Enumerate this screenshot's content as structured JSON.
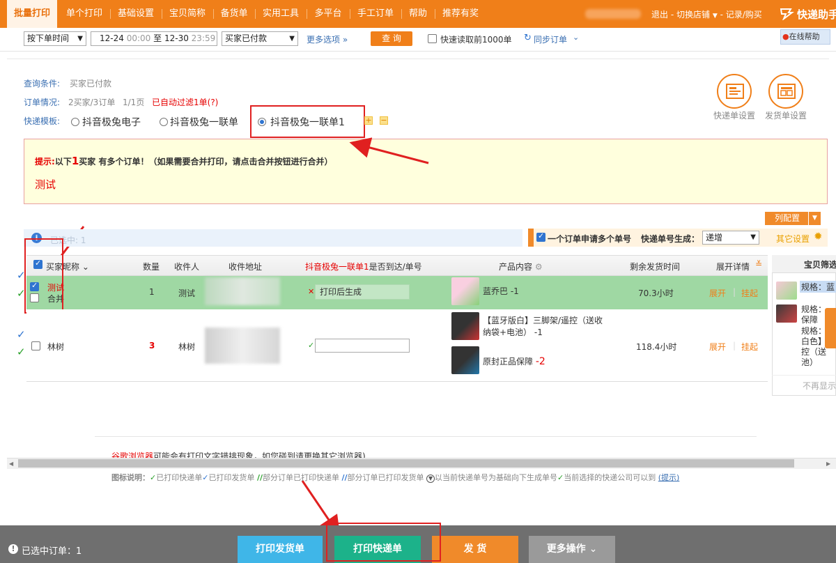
{
  "nav": {
    "items": [
      "批量打印",
      "单个打印",
      "基础设置",
      "宝贝简称",
      "备货单",
      "实用工具",
      "多平台",
      "手工订单",
      "帮助",
      "推荐有奖"
    ],
    "right_links": [
      "退出",
      "切换店铺",
      "记录/购买"
    ],
    "brand": "快递助手"
  },
  "query_bar": {
    "time_type": "按下单时间",
    "date_from": "12-24",
    "time_from": "00:00",
    "date_sep": "至",
    "date_to": "12-30",
    "time_to": "23:59",
    "status": "买家已付款",
    "more_options": "更多选项 »",
    "query_button": "查 询",
    "quick_read_label": "快速读取前1000单",
    "sync_orders": "同步订单",
    "online_help": "在线帮助"
  },
  "info": {
    "query_condition_label": "查询条件:",
    "query_condition_value": "买家已付款",
    "order_status_label": "订单情况:",
    "order_counts": "2买家/3订单",
    "pages": "1/1页",
    "auto_filter": "已自动过滤1单(?)",
    "template_label": "快递模板:",
    "templates": [
      "抖音极兔电子",
      "抖音极兔一联单",
      "抖音极兔一联单1"
    ],
    "selected_template_index": 2,
    "express_settings": "快递单设置",
    "invoice_settings": "发货单设置"
  },
  "notice": {
    "prefix": "提示:",
    "text_before": "以下",
    "count": "1",
    "text_after": "买家 有多个订单！（如果需要合并打印，请点击合并按钮进行合并）",
    "test_text": "测试"
  },
  "column_config_button": "列配置",
  "selected_bar": {
    "label": "已选中:",
    "count": "1"
  },
  "orange_bar": {
    "multi_number_label": "一个订单申请多个单号",
    "number_gen_label": "快递单号生成：",
    "number_gen_value": "递增",
    "other_settings": "其它设置"
  },
  "table": {
    "headers": {
      "buyer": "买家昵称",
      "qty": "数量",
      "receiver": "收件人",
      "address": "收件地址",
      "template_col_red": "抖音极兔一联单1",
      "template_col_black": "是否到达/单号",
      "product": "产品内容",
      "remaining": "剩余发货时间",
      "expand": "展开详情"
    },
    "rows": [
      {
        "buyer": "测试",
        "merge": "合并",
        "qty": "1",
        "receiver": "测试",
        "tracking_text": "打印后生成",
        "products": [
          {
            "name": "蓝乔巴",
            "qty": "-1"
          }
        ],
        "remaining": "70.3小时",
        "expand": "展开",
        "hold": "挂起"
      },
      {
        "buyer": "林树",
        "qty": "3",
        "receiver": "林树",
        "tracking_text": "",
        "products": [
          {
            "name": "【蓝牙版白】三脚架/遥控（送收纳袋+电池）",
            "qty": "-1"
          },
          {
            "name": "原封正品保障",
            "qty": "-2"
          }
        ],
        "remaining": "118.4小时",
        "expand": "展开",
        "hold": "挂起"
      }
    ]
  },
  "side_panel": {
    "title": "宝贝筛选",
    "spec1": "规格：蓝",
    "spec2a": "规格：",
    "spec2b": "保障",
    "spec3a": "规格：",
    "spec3b": "白色】",
    "spec3c": "控（送",
    "spec3d": "池）",
    "no_show": "不再显示"
  },
  "browser_notice": {
    "red": "谷歌浏览器",
    "text": "可能会有打印文字",
    "text2": "错排现象，如您碰到请更换其它浏览器)"
  },
  "legend": {
    "label": "图标说明：",
    "items": [
      "已打印快递单",
      "已打印发货单",
      "部分订单已打印快递单",
      "部分订单已打印发货单",
      "以当前快递单号为基础向下生成单号",
      "当前选择的快递公司可以到"
    ],
    "tip": "(提示)"
  },
  "bottom": {
    "selected_orders_label": "已选中订单：",
    "selected_orders_count": "1",
    "print_invoice": "打印发货单",
    "print_express": "打印快递单",
    "ship": "发 货",
    "more_ops": "更多操作"
  },
  "colors": {
    "nav_orange": "#f07f19",
    "row_green": "#9fd8a3",
    "annot_red": "#e02020",
    "btn_blue": "#3fb6e8",
    "btn_green": "#1cb28a",
    "btn_orange": "#f08a2a"
  }
}
